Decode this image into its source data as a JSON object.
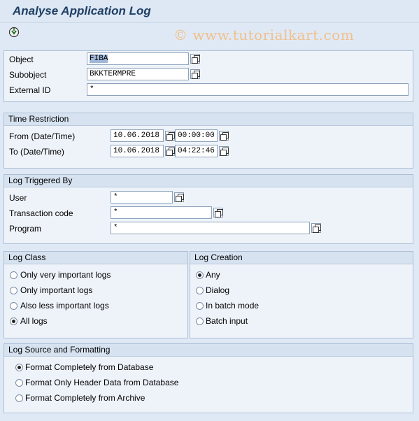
{
  "window": {
    "title": "Analyse Application Log",
    "watermark": "© www.tutorialkart.com"
  },
  "toolbar": {
    "execute_icon": "execute-icon"
  },
  "selection": {
    "object_label": "Object",
    "object_value": "FIBA",
    "subobject_label": "Subobject",
    "subobject_value": "BKKTERMPRE",
    "external_id_label": "External ID",
    "external_id_value": "*"
  },
  "time_restriction": {
    "title": "Time Restriction",
    "from_label": "From (Date/Time)",
    "from_date": "10.06.2018",
    "from_time": "00:00:00",
    "to_label": "To (Date/Time)",
    "to_date": "10.06.2018",
    "to_time": "04:22:46"
  },
  "log_triggered_by": {
    "title": "Log Triggered By",
    "user_label": "User",
    "user_value": "*",
    "tcode_label": "Transaction code",
    "tcode_value": "*",
    "program_label": "Program",
    "program_value": "*"
  },
  "log_class": {
    "title": "Log Class",
    "options": [
      {
        "label": "Only very important logs",
        "selected": false
      },
      {
        "label": "Only important logs",
        "selected": false
      },
      {
        "label": "Also less important logs",
        "selected": false
      },
      {
        "label": "All logs",
        "selected": true
      }
    ]
  },
  "log_creation": {
    "title": "Log Creation",
    "options": [
      {
        "label": "Any",
        "selected": true
      },
      {
        "label": "Dialog",
        "selected": false
      },
      {
        "label": "In batch mode",
        "selected": false
      },
      {
        "label": "Batch input",
        "selected": false
      }
    ]
  },
  "log_source": {
    "title": "Log Source and Formatting",
    "options": [
      {
        "label": "Format Completely from Database",
        "selected": true
      },
      {
        "label": "Format Only Header Data from Database",
        "selected": false
      },
      {
        "label": "Format Completely from Archive",
        "selected": false
      }
    ]
  }
}
